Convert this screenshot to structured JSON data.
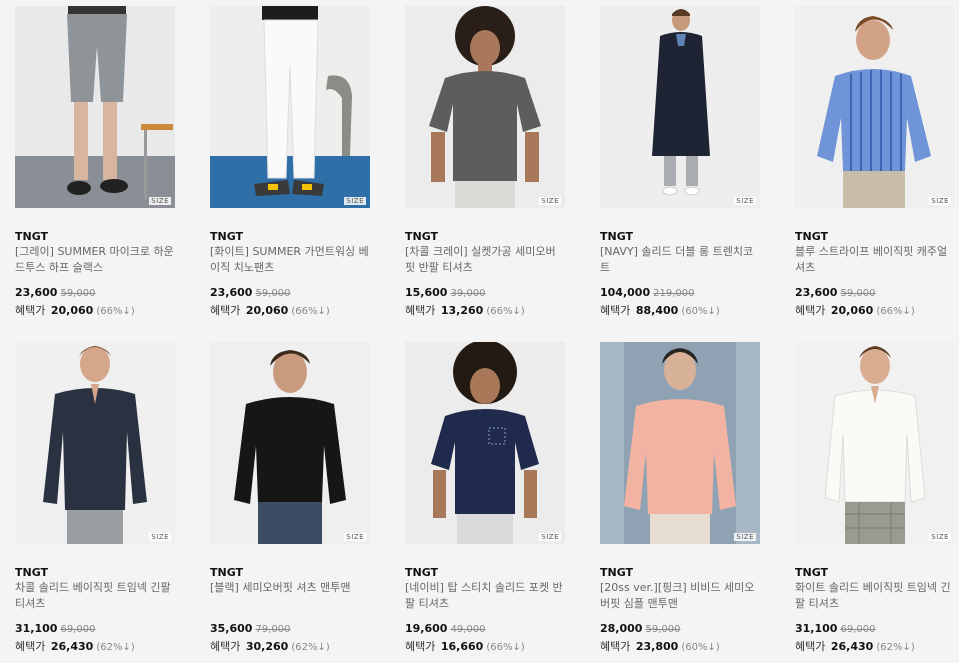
{
  "products": [
    {
      "brand": "TNGT",
      "name": "[그레이] SUMMER 마이크로 하운드투스 하프 슬랙스",
      "price": "23,600",
      "original_price": "59,000",
      "benefit_label": "혜택가",
      "benefit_price": "20,060",
      "benefit_rate": "(66%↓)",
      "size_badge": "SIZE"
    },
    {
      "brand": "TNGT",
      "name": "[화이트] SUMMER 가먼트워싱 베이직 치노팬츠",
      "price": "23,600",
      "original_price": "59,000",
      "benefit_label": "혜택가",
      "benefit_price": "20,060",
      "benefit_rate": "(66%↓)",
      "size_badge": "SIZE"
    },
    {
      "brand": "TNGT",
      "name": "[차콜 크레이] 실켓가공 세미오버핏 반팔 티셔츠",
      "price": "15,600",
      "original_price": "39,000",
      "benefit_label": "혜택가",
      "benefit_price": "13,260",
      "benefit_rate": "(66%↓)",
      "size_badge": "SIZE"
    },
    {
      "brand": "TNGT",
      "name": "[NAVY] 솔리드 더블 롱 트렌치코트",
      "price": "104,000",
      "original_price": "219,000",
      "benefit_label": "혜택가",
      "benefit_price": "88,400",
      "benefit_rate": "(60%↓)",
      "size_badge": "SIZE"
    },
    {
      "brand": "TNGT",
      "name": "블루 스트라이프 베이직핏 캐주얼 셔츠",
      "price": "23,600",
      "original_price": "59,000",
      "benefit_label": "혜택가",
      "benefit_price": "20,060",
      "benefit_rate": "(66%↓)",
      "size_badge": "SIZE"
    },
    {
      "brand": "TNGT",
      "name": "차콜 솔리드 베이직핏 트임넥 긴팔 티셔츠",
      "price": "31,100",
      "original_price": "69,000",
      "benefit_label": "혜택가",
      "benefit_price": "26,430",
      "benefit_rate": "(62%↓)",
      "size_badge": "SIZE"
    },
    {
      "brand": "TNGT",
      "name": "[블랙] 세미오버핏 셔츠 맨투맨",
      "price": "35,600",
      "original_price": "79,000",
      "benefit_label": "혜택가",
      "benefit_price": "30,260",
      "benefit_rate": "(62%↓)",
      "size_badge": "SIZE"
    },
    {
      "brand": "TNGT",
      "name": "[네이비] 탑 스티치 솔리드 포켓 반팔 티셔츠",
      "price": "19,600",
      "original_price": "49,000",
      "benefit_label": "혜택가",
      "benefit_price": "16,660",
      "benefit_rate": "(66%↓)",
      "size_badge": "SIZE"
    },
    {
      "brand": "TNGT",
      "name": "[20ss ver.][핑크] 비비드 세미오버핏 심플 맨투맨",
      "price": "28,000",
      "original_price": "59,000",
      "benefit_label": "혜택가",
      "benefit_price": "23,800",
      "benefit_rate": "(60%↓)",
      "size_badge": "SIZE"
    },
    {
      "brand": "TNGT",
      "name": "화이트 솔리드 베이직핏 트임넥 긴팔 티셔츠",
      "price": "31,100",
      "original_price": "69,000",
      "benefit_label": "혜택가",
      "benefit_price": "26,430",
      "benefit_rate": "(62%↓)",
      "size_badge": "SIZE"
    }
  ],
  "colors": {
    "background": "#f4f4f4",
    "price": "#111111",
    "muted": "#888888"
  }
}
